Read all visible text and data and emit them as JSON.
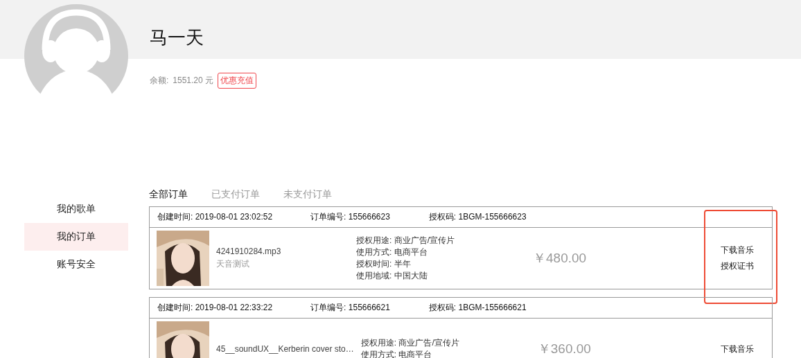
{
  "profile": {
    "name": "马一天",
    "balance_label": "余额:",
    "balance": "1551.20 元",
    "recharge": "优惠充值"
  },
  "sidebar": {
    "items": [
      {
        "label": "我的歌单",
        "selected": false
      },
      {
        "label": "我的订单",
        "selected": true
      },
      {
        "label": "账号安全",
        "selected": false
      }
    ]
  },
  "tabs": [
    {
      "label": "全部订单",
      "selected": true
    },
    {
      "label": "已支付订单",
      "selected": false
    },
    {
      "label": "未支付订单",
      "selected": false
    }
  ],
  "orders": [
    {
      "created": "创建时间: 2019-08-01 23:02:52",
      "order_no": "订单编号: 155666623",
      "auth_code": "授权码: 1BGM-155666623",
      "cover": {
        "kind": "picture"
      },
      "file": "4241910284.mp3",
      "artist": "天音测试",
      "details": [
        "授权用途: 商业广告/宣传片",
        "使用方式: 电商平台",
        "授权时间: 半年",
        "使用地域: 中国大陆"
      ],
      "price": "￥480.00",
      "actions": [
        "下载音乐",
        "授权证书"
      ],
      "highlighted": true
    },
    {
      "created": "创建时间: 2019-08-01 22:33:22",
      "order_no": "订单编号: 155666621",
      "auth_code": "授权码: 1BGM-155666621",
      "cover": {
        "kind": "picture"
      },
      "file": "45__soundUX__Kerberin cover sto…",
      "details": [
        "授权用途: 商业广告/宣传片",
        "使用方式: 电商平台"
      ],
      "price": "￥360.00",
      "actions": [
        "下载音乐"
      ],
      "highlighted": false
    }
  ]
}
